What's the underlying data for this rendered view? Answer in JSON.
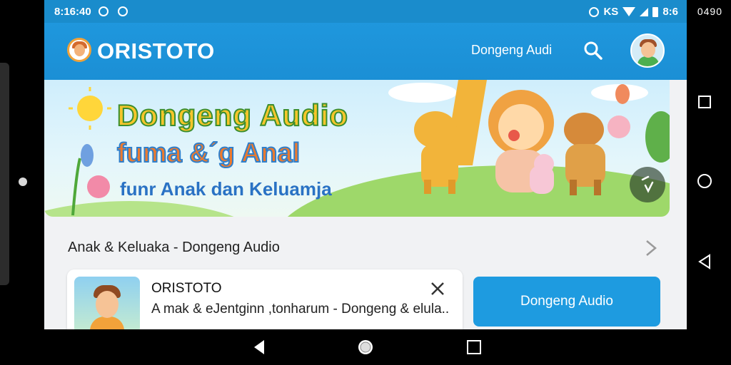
{
  "statusbar": {
    "time": "8:16:40",
    "right_text": "KS",
    "battery": "8:6",
    "corner": "0490"
  },
  "appbar": {
    "title": "ORISTOTO",
    "link": "Dongeng Audi"
  },
  "banner": {
    "line1": "Dongeng Audio",
    "line2": "fuma &´g Anal",
    "line3": "funr Anak dan Keluamja"
  },
  "section": {
    "title": "Anak & Keluaka - Dongeng Audio"
  },
  "card": {
    "title": "ORISTOTO",
    "subtitle": "A mak & eJentginn ,tonharum - Dongeng & elula.."
  },
  "primary_button": {
    "label": "Dongeng Audio"
  },
  "colors": {
    "appbar": "#1b8fd5",
    "button": "#1e9be0",
    "background": "#f1f2f4"
  },
  "icons": [
    "search-icon",
    "avatar",
    "chevron-right-icon",
    "close-icon",
    "back-icon",
    "home-icon",
    "recents-icon"
  ]
}
